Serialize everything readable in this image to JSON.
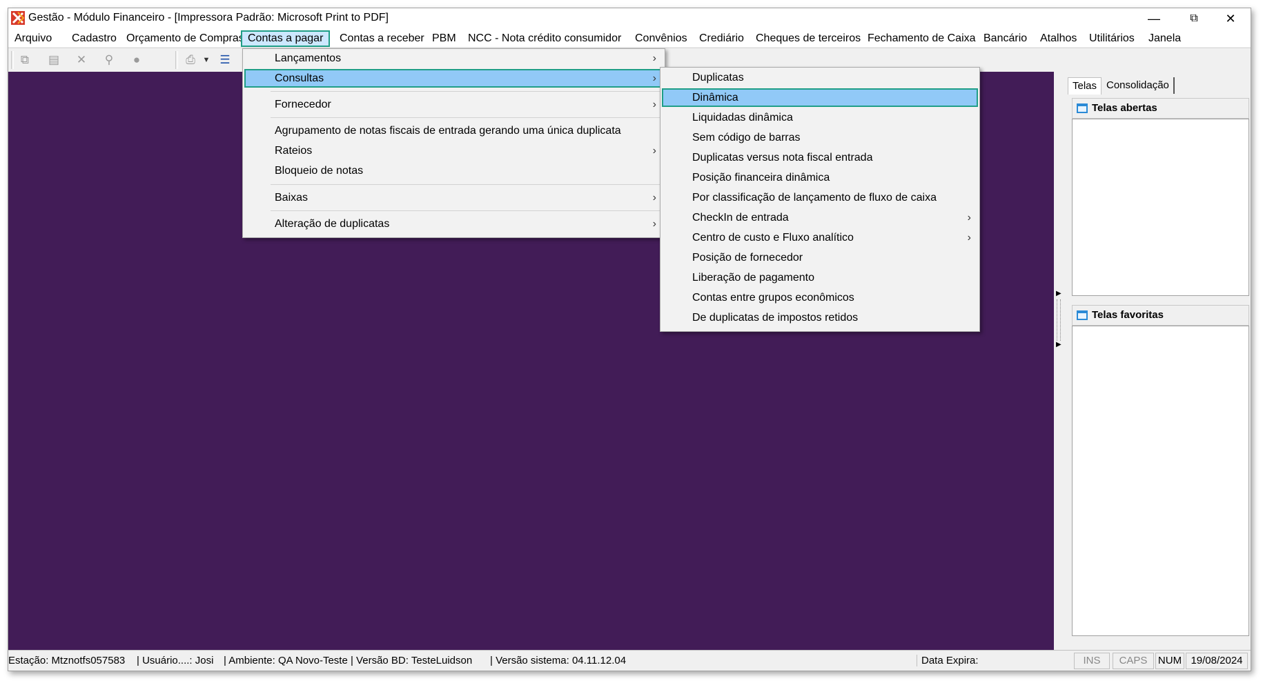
{
  "window": {
    "title": "Gestão  - Módulo Financeiro - [Impressora Padrão: Microsoft Print to PDF]",
    "logo_icon": "app-logo-icon",
    "controls": {
      "minimize": "—",
      "restore": "⧉",
      "close": "✕"
    }
  },
  "menubar": {
    "items": [
      "Arquivo",
      "Cadastro",
      "Orçamento de Compras",
      "Contas a pagar",
      "Contas a receber",
      "PBM",
      "NCC - Nota crédito consumidor",
      "Convênios",
      "Crediário",
      "Cheques de terceiros",
      "Fechamento de Caixa",
      "Bancário",
      "Atalhos",
      "Utilitários",
      "Janela"
    ],
    "active": "Contas a pagar"
  },
  "toolbar": {
    "icons": [
      "copy-icon",
      "paste-icon",
      "delete-icon",
      "search-icon",
      "record-icon",
      "print-icon",
      "list-icon"
    ]
  },
  "menu_contas_pagar": {
    "items": [
      {
        "label": "Lançamentos",
        "submenu": true
      },
      {
        "label": "Consultas",
        "submenu": true,
        "highlighted": true
      },
      {
        "label": "Fornecedor",
        "submenu": true
      },
      {
        "label": "Agrupamento de notas fiscais de entrada gerando uma única duplicata",
        "submenu": false
      },
      {
        "label": "Rateios",
        "submenu": true
      },
      {
        "label": "Bloqueio de notas",
        "submenu": false
      },
      {
        "label": "Baixas",
        "submenu": true
      },
      {
        "label": "Alteração de duplicatas",
        "submenu": true
      }
    ]
  },
  "menu_consultas": {
    "items": [
      {
        "label": "Duplicatas",
        "submenu": false
      },
      {
        "label": "Dinâmica",
        "submenu": false,
        "highlighted": true
      },
      {
        "label": "Liquidadas dinâmica",
        "submenu": false
      },
      {
        "label": "Sem código de barras",
        "submenu": false
      },
      {
        "label": "Duplicatas versus nota fiscal entrada",
        "submenu": false
      },
      {
        "label": "Posição financeira dinâmica",
        "submenu": false
      },
      {
        "label": "Por classificação de lançamento de fluxo de caixa",
        "submenu": false
      },
      {
        "label": "CheckIn de entrada",
        "submenu": true
      },
      {
        "label": "Centro de custo e Fluxo analítico",
        "submenu": true
      },
      {
        "label": "Posição de fornecedor",
        "submenu": false
      },
      {
        "label": "Liberação de pagamento",
        "submenu": false
      },
      {
        "label": "Contas entre grupos econômicos",
        "submenu": false
      },
      {
        "label": "De duplicatas de impostos retidos",
        "submenu": false
      }
    ]
  },
  "right_panel": {
    "tabs": [
      "Telas",
      "Consolidação"
    ],
    "open_screens_title": "Telas abertas",
    "favorite_screens_title": "Telas favoritas"
  },
  "statusbar": {
    "station": "Estação: Mtznotfs057583",
    "user": "| Usuário....: Josi",
    "environment": "| Ambiente: QA Novo-Teste | Versão BD: TesteLuidson",
    "version": "| Versão sistema: 04.11.12.04",
    "expiry": "Data Expira:",
    "ins": "INS",
    "caps": "CAPS",
    "num": "NUM",
    "date": "19/08/2024"
  },
  "colors": {
    "workspace": "#421c57",
    "highlight_border": "#1f9e87",
    "menu_highlight": "#91c9f7"
  }
}
